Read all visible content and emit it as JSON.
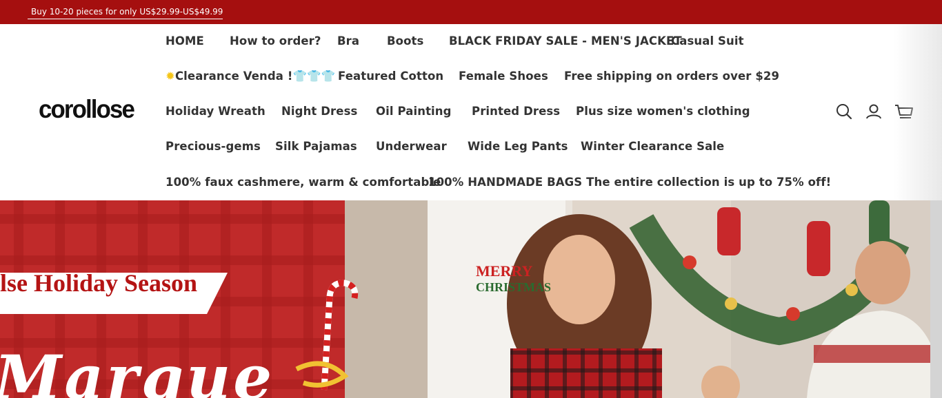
{
  "announcement": {
    "text": "Buy 10-20 pieces for only US$29.99-US$49.99"
  },
  "brand": {
    "logo_text": "corollose"
  },
  "nav": {
    "row1": [
      "HOME",
      "How to order?",
      "Bra",
      "Boots",
      "BLACK FRIDAY SALE - MEN'S JACKET",
      "Casual Suit"
    ],
    "row2": [
      "Clearance Venda !",
      "Featured Cotton",
      "Female Shoes",
      "Free shipping on orders over $29"
    ],
    "row3": [
      "Holiday Wreath",
      "Night Dress",
      "Oil Painting",
      "Printed Dress",
      "Plus size women's clothing"
    ],
    "row4": [
      "Precious-gems",
      "Silk Pajamas",
      "Underwear",
      "Wide Leg Pants",
      "Winter Clearance Sale"
    ],
    "row5": [
      "100% faux cashmere, warm & comfortable",
      "100% HANDMADE BAGS The entire collection is up to 75% off!"
    ]
  },
  "header_icons": [
    "search-icon",
    "account-icon",
    "cart-icon"
  ],
  "hero": {
    "headline": "lse Holiday Season",
    "script_text": "Marque",
    "sign_text": "MERRY CHRISTMAS"
  },
  "colors": {
    "announcement_bg": "#a50f0f",
    "nav_text": "#333333",
    "hero_red": "#b52323"
  }
}
